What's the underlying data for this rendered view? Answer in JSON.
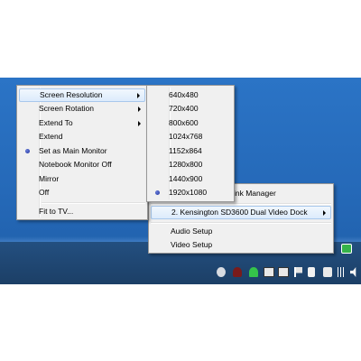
{
  "main_menu": {
    "items": [
      {
        "label": "Screen Resolution",
        "submenu": true,
        "highlighted": true,
        "checked": false
      },
      {
        "label": "Screen Rotation",
        "submenu": true,
        "highlighted": false,
        "checked": false
      },
      {
        "label": "Extend To",
        "submenu": true,
        "highlighted": false,
        "checked": false
      },
      {
        "label": "Extend",
        "submenu": false,
        "highlighted": false,
        "checked": false
      },
      {
        "label": "Set as Main Monitor",
        "submenu": false,
        "highlighted": false,
        "checked": true
      },
      {
        "label": "Notebook Monitor Off",
        "submenu": false,
        "highlighted": false,
        "checked": false
      },
      {
        "label": "Mirror",
        "submenu": false,
        "highlighted": false,
        "checked": false
      },
      {
        "label": "Off",
        "submenu": false,
        "highlighted": false,
        "checked": false
      },
      {
        "label": "Fit to TV...",
        "submenu": false,
        "highlighted": false,
        "checked": false
      }
    ]
  },
  "resolution_menu": {
    "items": [
      {
        "label": "640x480",
        "checked": false
      },
      {
        "label": "720x400",
        "checked": false
      },
      {
        "label": "800x600",
        "checked": false
      },
      {
        "label": "1024x768",
        "checked": false
      },
      {
        "label": "1152x864",
        "checked": false
      },
      {
        "label": "1280x800",
        "checked": false
      },
      {
        "label": "1440x900",
        "checked": false
      },
      {
        "label": "1920x1080",
        "checked": true
      }
    ]
  },
  "device_menu": {
    "items": [
      {
        "label": "ink Manager",
        "submenu": false,
        "highlighted": false
      },
      {
        "label": "2. Kensington SD3600 Dual Video Dock",
        "submenu": true,
        "highlighted": true
      },
      {
        "label": "Audio Setup",
        "submenu": false,
        "highlighted": false
      },
      {
        "label": "Video Setup",
        "submenu": false,
        "highlighted": false
      }
    ]
  },
  "tray": {
    "icons": [
      "tray-app-icon",
      "tray-shield-icon",
      "tray-wireless-icon",
      "tray-display-icon",
      "tray-monitor-icon",
      "tray-flag-icon",
      "tray-device-icon",
      "tray-battery-icon",
      "tray-signal-icon",
      "tray-volume-icon",
      "tray-display-link-icon"
    ]
  },
  "colors": {
    "desktop": "#2569b8",
    "menu_bg": "#f0f0f0",
    "highlight_border": "#a8c8ec",
    "radio": "#1b2f9e"
  }
}
